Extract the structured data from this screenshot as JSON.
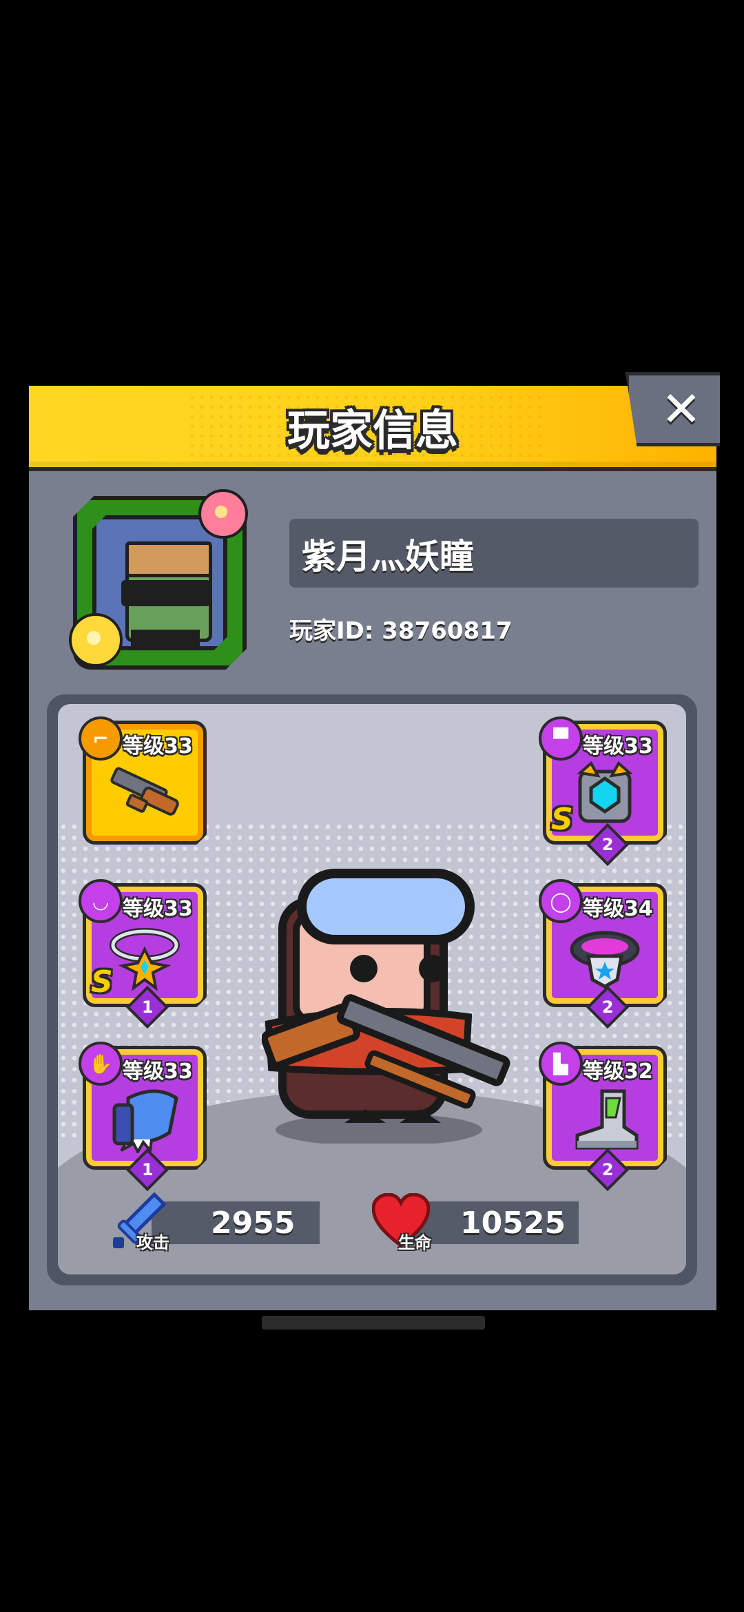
{
  "dialog": {
    "title": "玩家信息",
    "close_symbol": "✕"
  },
  "player": {
    "name": "紫月灬妖瞳",
    "id_label": "玩家ID: 38760817"
  },
  "equipment": [
    {
      "slot": "weapon",
      "level_label": "等级33",
      "icon": "pistol-icon",
      "item_icon": "shotgun-icon",
      "rarity_color": "#ffcc00"
    },
    {
      "slot": "armor",
      "level_label": "等级33",
      "icon": "shirt-icon",
      "item_icon": "armor-icon",
      "rank": "S",
      "stars": "2",
      "rarity_color": "#b53ee0"
    },
    {
      "slot": "necklace",
      "level_label": "等级33",
      "icon": "necklace-icon",
      "item_icon": "necklace-item-icon",
      "rank": "S",
      "stars": "1",
      "rarity_color": "#b53ee0"
    },
    {
      "slot": "belt",
      "level_label": "等级34",
      "icon": "belt-icon",
      "item_icon": "belt-item-icon",
      "stars": "2",
      "rarity_color": "#b53ee0"
    },
    {
      "slot": "gloves",
      "level_label": "等级33",
      "icon": "glove-icon",
      "item_icon": "claw-glove-icon",
      "stars": "1",
      "rarity_color": "#b53ee0"
    },
    {
      "slot": "boots",
      "level_label": "等级32",
      "icon": "boot-icon",
      "item_icon": "boot-item-icon",
      "stars": "2",
      "rarity_color": "#b53ee0"
    }
  ],
  "stats": {
    "attack_label": "攻击",
    "attack_value": "2955",
    "health_label": "生命",
    "health_value": "10525"
  }
}
